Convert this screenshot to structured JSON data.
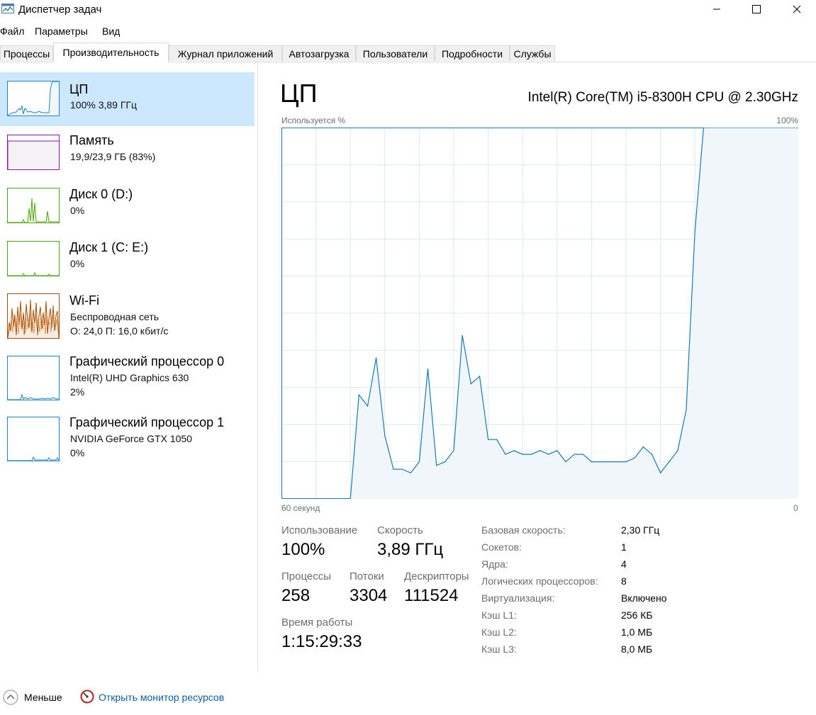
{
  "app": {
    "title": "Диспетчер задач"
  },
  "menu": [
    "Файл",
    "Параметры",
    "Вид"
  ],
  "tabs": [
    "Процессы",
    "Производительность",
    "Журнал приложений",
    "Автозагрузка",
    "Пользователи",
    "Подробности",
    "Службы"
  ],
  "active_tab": "Производительность",
  "sidebar": {
    "items": [
      {
        "title": "ЦП",
        "lines": [
          "100%  3,89 ГГц"
        ],
        "color": "#1a85c8",
        "selected": true
      },
      {
        "title": "Память",
        "lines": [
          "19,9/23,9 ГБ (83%)"
        ],
        "color": "#8b12ae",
        "usage": 0.83
      },
      {
        "title": "Диск 0 (D:)",
        "lines": [
          "0%"
        ],
        "color": "#4da60c"
      },
      {
        "title": "Диск 1 (C: E:)",
        "lines": [
          "0%"
        ],
        "color": "#4da60c"
      },
      {
        "title": "Wi-Fi",
        "lines": [
          "Беспроводная сеть",
          "О: 24,0  П: 16,0 кбит/с"
        ],
        "color": "#a74f01"
      },
      {
        "title": "Графический процессор 0",
        "lines": [
          "Intel(R) UHD Graphics 630",
          "2%"
        ],
        "color": "#1a85c8"
      },
      {
        "title": "Графический процессор 1",
        "lines": [
          "NVIDIA GeForce GTX 1050",
          "0%"
        ],
        "color": "#1a85c8"
      }
    ]
  },
  "main": {
    "title": "ЦП",
    "model": "Intel(R) Core(TM) i5-8300H CPU @ 2.30GHz",
    "graph_label": "Используется %",
    "graph_max": "100%",
    "x_left": "60 секунд",
    "x_right": "0"
  },
  "chart_data": {
    "type": "area",
    "color": "#117dbb",
    "fill": "#f1f6fa",
    "ylim": [
      0,
      100
    ],
    "xlim": [
      60,
      0
    ],
    "x": [
      60,
      52,
      51,
      50,
      49,
      48,
      47,
      46,
      45,
      44,
      43,
      42,
      41,
      40,
      39,
      38,
      37,
      36,
      35,
      34,
      33,
      32,
      31,
      30,
      29,
      28,
      27,
      26,
      25,
      24,
      23,
      22,
      21,
      20,
      19,
      18,
      17,
      16,
      15,
      14,
      13,
      12,
      11,
      10,
      9,
      8,
      7,
      6,
      5,
      4,
      3,
      2,
      1,
      0
    ],
    "values": [
      0,
      0,
      28,
      25,
      38,
      17,
      8,
      8,
      7,
      10,
      35,
      9,
      10,
      13,
      44,
      31,
      33,
      16,
      16,
      12,
      13,
      12,
      12,
      13,
      12,
      13,
      10,
      12,
      12,
      10,
      10,
      10,
      10,
      10,
      11,
      14,
      12,
      7,
      10,
      13,
      24,
      72,
      100,
      100,
      100,
      100,
      100,
      100,
      100,
      100,
      100,
      100,
      100,
      100
    ]
  },
  "stats": {
    "usage_label": "Использование",
    "usage": "100%",
    "speed_label": "Скорость",
    "speed": "3,89 ГГц",
    "processes_label": "Процессы",
    "processes": "258",
    "threads_label": "Потоки",
    "threads": "3304",
    "handles_label": "Дескрипторы",
    "handles": "111524",
    "uptime_label": "Время работы",
    "uptime": "1:15:29:33"
  },
  "info": [
    {
      "label": "Базовая скорость:",
      "value": "2,30 ГГц"
    },
    {
      "label": "Сокетов:",
      "value": "1"
    },
    {
      "label": "Ядра:",
      "value": "4"
    },
    {
      "label": "Логических процессоров:",
      "value": "8"
    },
    {
      "label": "Виртуализация:",
      "value": "Включено"
    },
    {
      "label": "Кэш L1:",
      "value": "256 КБ"
    },
    {
      "label": "Кэш L2:",
      "value": "1,0 МБ"
    },
    {
      "label": "Кэш L3:",
      "value": "8,0 МБ"
    }
  ],
  "footer": {
    "less": "Меньше",
    "resmon": "Открыть монитор ресурсов"
  }
}
